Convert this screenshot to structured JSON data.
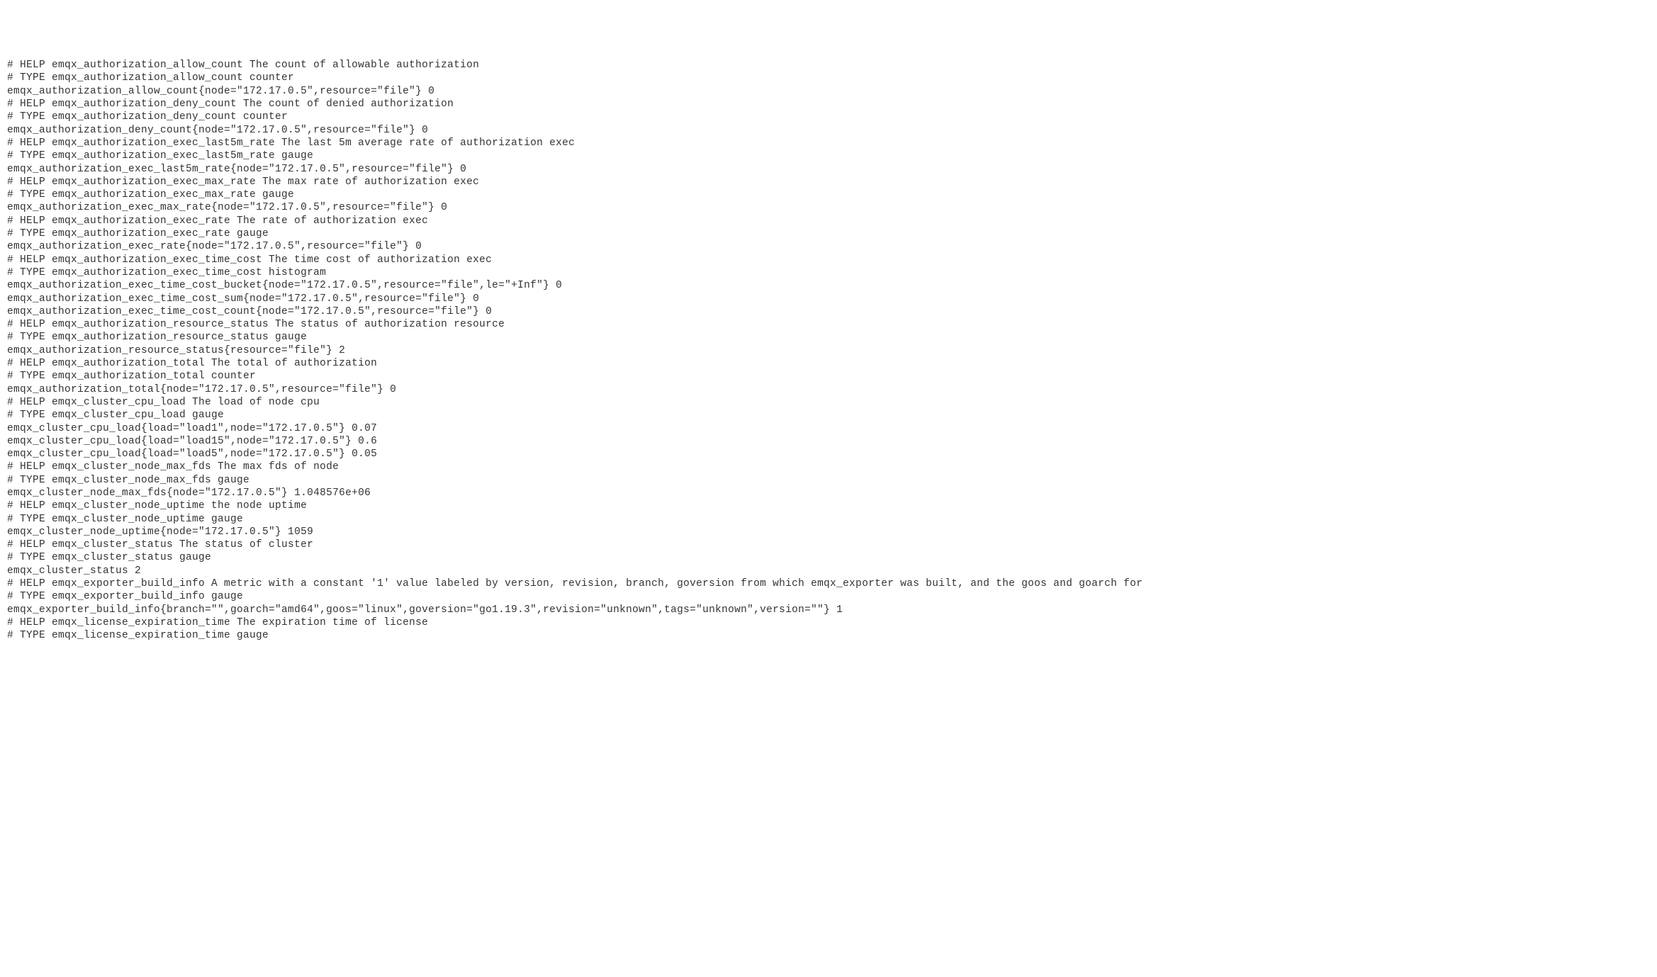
{
  "lines": [
    "# HELP emqx_authorization_allow_count The count of allowable authorization",
    "# TYPE emqx_authorization_allow_count counter",
    "emqx_authorization_allow_count{node=\"172.17.0.5\",resource=\"file\"} 0",
    "# HELP emqx_authorization_deny_count The count of denied authorization",
    "# TYPE emqx_authorization_deny_count counter",
    "emqx_authorization_deny_count{node=\"172.17.0.5\",resource=\"file\"} 0",
    "# HELP emqx_authorization_exec_last5m_rate The last 5m average rate of authorization exec",
    "# TYPE emqx_authorization_exec_last5m_rate gauge",
    "emqx_authorization_exec_last5m_rate{node=\"172.17.0.5\",resource=\"file\"} 0",
    "# HELP emqx_authorization_exec_max_rate The max rate of authorization exec",
    "# TYPE emqx_authorization_exec_max_rate gauge",
    "emqx_authorization_exec_max_rate{node=\"172.17.0.5\",resource=\"file\"} 0",
    "# HELP emqx_authorization_exec_rate The rate of authorization exec",
    "# TYPE emqx_authorization_exec_rate gauge",
    "emqx_authorization_exec_rate{node=\"172.17.0.5\",resource=\"file\"} 0",
    "# HELP emqx_authorization_exec_time_cost The time cost of authorization exec",
    "# TYPE emqx_authorization_exec_time_cost histogram",
    "emqx_authorization_exec_time_cost_bucket{node=\"172.17.0.5\",resource=\"file\",le=\"+Inf\"} 0",
    "emqx_authorization_exec_time_cost_sum{node=\"172.17.0.5\",resource=\"file\"} 0",
    "emqx_authorization_exec_time_cost_count{node=\"172.17.0.5\",resource=\"file\"} 0",
    "# HELP emqx_authorization_resource_status The status of authorization resource",
    "# TYPE emqx_authorization_resource_status gauge",
    "emqx_authorization_resource_status{resource=\"file\"} 2",
    "# HELP emqx_authorization_total The total of authorization",
    "# TYPE emqx_authorization_total counter",
    "emqx_authorization_total{node=\"172.17.0.5\",resource=\"file\"} 0",
    "# HELP emqx_cluster_cpu_load The load of node cpu",
    "# TYPE emqx_cluster_cpu_load gauge",
    "emqx_cluster_cpu_load{load=\"load1\",node=\"172.17.0.5\"} 0.07",
    "emqx_cluster_cpu_load{load=\"load15\",node=\"172.17.0.5\"} 0.6",
    "emqx_cluster_cpu_load{load=\"load5\",node=\"172.17.0.5\"} 0.05",
    "# HELP emqx_cluster_node_max_fds The max fds of node",
    "# TYPE emqx_cluster_node_max_fds gauge",
    "emqx_cluster_node_max_fds{node=\"172.17.0.5\"} 1.048576e+06",
    "# HELP emqx_cluster_node_uptime the node uptime",
    "# TYPE emqx_cluster_node_uptime gauge",
    "emqx_cluster_node_uptime{node=\"172.17.0.5\"} 1059",
    "# HELP emqx_cluster_status The status of cluster",
    "# TYPE emqx_cluster_status gauge",
    "emqx_cluster_status 2",
    "# HELP emqx_exporter_build_info A metric with a constant '1' value labeled by version, revision, branch, goversion from which emqx_exporter was built, and the goos and goarch for",
    "# TYPE emqx_exporter_build_info gauge",
    "emqx_exporter_build_info{branch=\"\",goarch=\"amd64\",goos=\"linux\",goversion=\"go1.19.3\",revision=\"unknown\",tags=\"unknown\",version=\"\"} 1",
    "# HELP emqx_license_expiration_time The expiration time of license",
    "# TYPE emqx_license_expiration_time gauge"
  ]
}
